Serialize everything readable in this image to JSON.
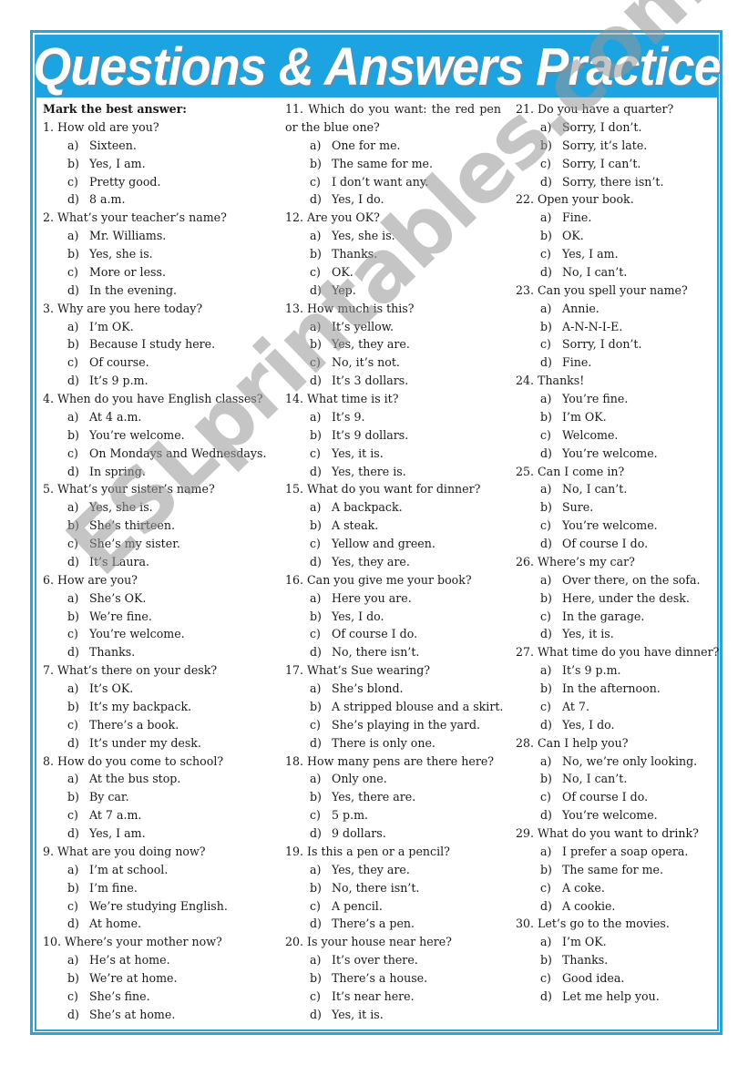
{
  "title": "Questions & Answers Practice",
  "instruction": "Mark the best answer:",
  "watermark": "ESLprintables.com",
  "colors": {
    "frame": "#2ba3d6",
    "banner": "#1ba4e1",
    "title_text": "#ffffff"
  },
  "columns": [
    {
      "questions": [
        {
          "number": "1.",
          "text": "How old are you?",
          "options": [
            {
              "letter": "a)",
              "text": "Sixteen."
            },
            {
              "letter": "b)",
              "text": "Yes, I am."
            },
            {
              "letter": "c)",
              "text": "Pretty good."
            },
            {
              "letter": "d)",
              "text": "8 a.m."
            }
          ]
        },
        {
          "number": "2.",
          "text": "What’s your teacher’s name?",
          "options": [
            {
              "letter": "a)",
              "text": "Mr. Williams."
            },
            {
              "letter": "b)",
              "text": "Yes, she is."
            },
            {
              "letter": "c)",
              "text": "More or less."
            },
            {
              "letter": "d)",
              "text": "In the evening."
            }
          ]
        },
        {
          "number": "3.",
          "text": "Why are you here today?",
          "options": [
            {
              "letter": "a)",
              "text": "I’m OK."
            },
            {
              "letter": "b)",
              "text": "Because I study here."
            },
            {
              "letter": "c)",
              "text": "Of course."
            },
            {
              "letter": "d)",
              "text": "It’s 9 p.m."
            }
          ]
        },
        {
          "number": "4.",
          "text": "When do you have English classes?",
          "options": [
            {
              "letter": "a)",
              "text": "At 4 a.m."
            },
            {
              "letter": "b)",
              "text": "You’re welcome."
            },
            {
              "letter": "c)",
              "text": "On Mondays and Wednesdays."
            },
            {
              "letter": "d)",
              "text": "In spring."
            }
          ]
        },
        {
          "number": "5.",
          "text": "What’s your sister’s name?",
          "options": [
            {
              "letter": "a)",
              "text": "Yes, she is."
            },
            {
              "letter": "b)",
              "text": "She’s thirteen."
            },
            {
              "letter": "c)",
              "text": "She’s my sister."
            },
            {
              "letter": "d)",
              "text": "It’s Laura."
            }
          ]
        },
        {
          "number": "6.",
          "text": "How are you?",
          "options": [
            {
              "letter": "a)",
              "text": "She’s OK."
            },
            {
              "letter": "b)",
              "text": "We’re fine."
            },
            {
              "letter": "c)",
              "text": "You’re welcome."
            },
            {
              "letter": "d)",
              "text": "Thanks."
            }
          ]
        },
        {
          "number": "7.",
          "text": "What’s there on your desk?",
          "options": [
            {
              "letter": "a)",
              "text": "It’s OK."
            },
            {
              "letter": "b)",
              "text": "It’s my backpack."
            },
            {
              "letter": "c)",
              "text": "There’s a book."
            },
            {
              "letter": "d)",
              "text": "It’s under my desk."
            }
          ]
        },
        {
          "number": "8.",
          "text": "How do you come to school?",
          "options": [
            {
              "letter": "a)",
              "text": "At the bus stop."
            },
            {
              "letter": "b)",
              "text": "By car."
            },
            {
              "letter": "c)",
              "text": "At 7 a.m."
            },
            {
              "letter": "d)",
              "text": "Yes, I am."
            }
          ]
        },
        {
          "number": "9.",
          "text": "What are you doing now?",
          "options": [
            {
              "letter": "a)",
              "text": "I’m at school."
            },
            {
              "letter": "b)",
              "text": "I’m fine."
            },
            {
              "letter": "c)",
              "text": "We’re studying English."
            },
            {
              "letter": "d)",
              "text": "At home."
            }
          ]
        },
        {
          "number": "10.",
          "text": "Where’s your mother now?",
          "options": [
            {
              "letter": "a)",
              "text": "He’s at home."
            },
            {
              "letter": "b)",
              "text": "We’re at home."
            },
            {
              "letter": "c)",
              "text": "She’s fine."
            },
            {
              "letter": "d)",
              "text": "She’s at home."
            }
          ]
        }
      ]
    },
    {
      "questions": [
        {
          "number": "11.",
          "text": "Which do you want: the red pen or the blue one?",
          "options": [
            {
              "letter": "a)",
              "text": "One for me."
            },
            {
              "letter": "b)",
              "text": "The same for me."
            },
            {
              "letter": "c)",
              "text": "I don’t want any."
            },
            {
              "letter": "d)",
              "text": "Yes, I do."
            }
          ]
        },
        {
          "number": "12.",
          "text": "Are you OK?",
          "options": [
            {
              "letter": "a)",
              "text": "Yes, she is."
            },
            {
              "letter": "b)",
              "text": "Thanks."
            },
            {
              "letter": "c)",
              "text": "OK."
            },
            {
              "letter": "d)",
              "text": "Yep."
            }
          ]
        },
        {
          "number": "13.",
          "text": "How much is this?",
          "options": [
            {
              "letter": "a)",
              "text": "It’s yellow."
            },
            {
              "letter": "b)",
              "text": "Yes, they are."
            },
            {
              "letter": "c)",
              "text": "No, it’s not."
            },
            {
              "letter": "d)",
              "text": "It’s 3 dollars."
            }
          ]
        },
        {
          "number": "14.",
          "text": "What time is it?",
          "options": [
            {
              "letter": "a)",
              "text": "It’s 9."
            },
            {
              "letter": "b)",
              "text": "It’s 9 dollars."
            },
            {
              "letter": "c)",
              "text": "Yes, it is."
            },
            {
              "letter": "d)",
              "text": "Yes, there is."
            }
          ]
        },
        {
          "number": "15.",
          "text": "What do you want for dinner?",
          "options": [
            {
              "letter": "a)",
              "text": "A backpack."
            },
            {
              "letter": "b)",
              "text": "A steak."
            },
            {
              "letter": "c)",
              "text": "Yellow and green."
            },
            {
              "letter": "d)",
              "text": "Yes, they are."
            }
          ]
        },
        {
          "number": "16.",
          "text": "Can you give me your book?",
          "options": [
            {
              "letter": "a)",
              "text": "Here you are."
            },
            {
              "letter": "b)",
              "text": "Yes, I do."
            },
            {
              "letter": "c)",
              "text": "Of course I do."
            },
            {
              "letter": "d)",
              "text": "No, there isn’t."
            }
          ]
        },
        {
          "number": "17.",
          "text": "What’s Sue wearing?",
          "options": [
            {
              "letter": "a)",
              "text": "She’s blond."
            },
            {
              "letter": "b)",
              "text": "A stripped blouse and a skirt."
            },
            {
              "letter": "c)",
              "text": "She’s playing in the yard."
            },
            {
              "letter": "d)",
              "text": "There is only one."
            }
          ]
        },
        {
          "number": "18.",
          "text": "How many pens are there here?",
          "options": [
            {
              "letter": "a)",
              "text": "Only one."
            },
            {
              "letter": "b)",
              "text": "Yes, there are."
            },
            {
              "letter": "c)",
              "text": "5 p.m."
            },
            {
              "letter": "d)",
              "text": "9 dollars."
            }
          ]
        },
        {
          "number": "19.",
          "text": "Is this a pen or a pencil?",
          "options": [
            {
              "letter": "a)",
              "text": "Yes, they are."
            },
            {
              "letter": "b)",
              "text": "No, there isn’t."
            },
            {
              "letter": "c)",
              "text": "A pencil."
            },
            {
              "letter": "d)",
              "text": "There’s a pen."
            }
          ]
        },
        {
          "number": "20.",
          "text": "Is your house near here?",
          "options": [
            {
              "letter": "a)",
              "text": "It’s over there."
            },
            {
              "letter": "b)",
              "text": "There’s a house."
            },
            {
              "letter": "c)",
              "text": "It’s near here."
            },
            {
              "letter": "d)",
              "text": "Yes, it is."
            }
          ]
        }
      ]
    },
    {
      "questions": [
        {
          "number": "21.",
          "text": "Do you have a quarter?",
          "options": [
            {
              "letter": "a)",
              "text": "Sorry, I don’t."
            },
            {
              "letter": "b)",
              "text": "Sorry, it’s late."
            },
            {
              "letter": "c)",
              "text": "Sorry, I can’t."
            },
            {
              "letter": "d)",
              "text": "Sorry, there isn’t."
            }
          ]
        },
        {
          "number": "22.",
          "text": "Open your book.",
          "options": [
            {
              "letter": "a)",
              "text": "Fine."
            },
            {
              "letter": "b)",
              "text": "OK."
            },
            {
              "letter": "c)",
              "text": "Yes, I am."
            },
            {
              "letter": "d)",
              "text": "No, I can’t."
            }
          ]
        },
        {
          "number": "23.",
          "text": "Can you spell your name?",
          "options": [
            {
              "letter": "a)",
              "text": "Annie."
            },
            {
              "letter": "b)",
              "text": "A-N-N-I-E."
            },
            {
              "letter": "c)",
              "text": "Sorry, I don’t."
            },
            {
              "letter": "d)",
              "text": "Fine."
            }
          ]
        },
        {
          "number": "24.",
          "text": "Thanks!",
          "options": [
            {
              "letter": "a)",
              "text": "You’re fine."
            },
            {
              "letter": "b)",
              "text": "I’m OK."
            },
            {
              "letter": "c)",
              "text": "Welcome."
            },
            {
              "letter": "d)",
              "text": "You’re welcome."
            }
          ]
        },
        {
          "number": "25.",
          "text": "Can I come in?",
          "options": [
            {
              "letter": "a)",
              "text": "No, I can’t."
            },
            {
              "letter": "b)",
              "text": "Sure."
            },
            {
              "letter": "c)",
              "text": "You’re welcome."
            },
            {
              "letter": "d)",
              "text": "Of course I do."
            }
          ]
        },
        {
          "number": "26.",
          "text": "Where’s my car?",
          "options": [
            {
              "letter": "a)",
              "text": "Over there, on the sofa."
            },
            {
              "letter": "b)",
              "text": "Here, under the desk."
            },
            {
              "letter": "c)",
              "text": "In the garage."
            },
            {
              "letter": "d)",
              "text": "Yes, it is."
            }
          ]
        },
        {
          "number": "27.",
          "text": "What time do you have dinner?",
          "options": [
            {
              "letter": "a)",
              "text": "It’s 9 p.m."
            },
            {
              "letter": "b)",
              "text": "In the afternoon."
            },
            {
              "letter": "c)",
              "text": "At 7."
            },
            {
              "letter": "d)",
              "text": "Yes, I do."
            }
          ]
        },
        {
          "number": "28.",
          "text": "Can I help you?",
          "options": [
            {
              "letter": "a)",
              "text": "No, we’re only looking."
            },
            {
              "letter": "b)",
              "text": "No, I can’t."
            },
            {
              "letter": "c)",
              "text": "Of course I do."
            },
            {
              "letter": "d)",
              "text": "You’re welcome."
            }
          ]
        },
        {
          "number": "29.",
          "text": "What do you want to drink?",
          "options": [
            {
              "letter": "a)",
              "text": "I prefer a soap opera."
            },
            {
              "letter": "b)",
              "text": "The same for me."
            },
            {
              "letter": "c)",
              "text": "A coke."
            },
            {
              "letter": "d)",
              "text": "A cookie."
            }
          ]
        },
        {
          "number": "30.",
          "text": "Let’s go to the movies.",
          "options": [
            {
              "letter": "a)",
              "text": "I’m OK."
            },
            {
              "letter": "b)",
              "text": "Thanks."
            },
            {
              "letter": "c)",
              "text": "Good idea."
            },
            {
              "letter": "d)",
              "text": "Let me help you."
            }
          ]
        }
      ]
    }
  ]
}
